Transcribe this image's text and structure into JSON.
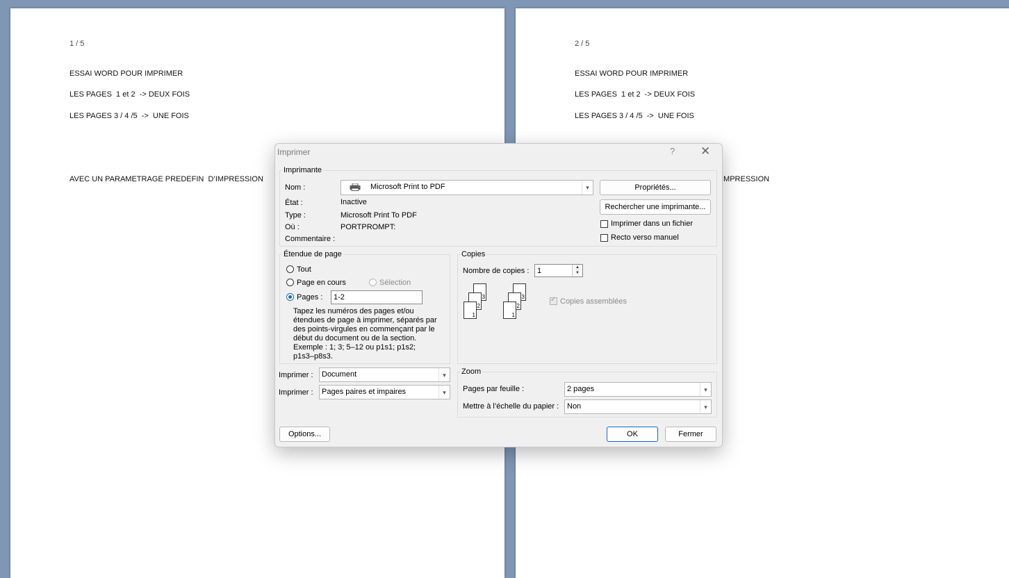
{
  "document": {
    "page_left": {
      "page_number": "1 / 5",
      "lines": [
        "ESSAI WORD POUR IMPRIMER",
        "LES PAGES  1 et 2  -> DEUX FOIS",
        "LES PAGES 3 / 4 /5  ->  UNE FOIS",
        "AVEC UN PARAMETRAGE PREDEFIN  D’IMPRESSION"
      ]
    },
    "page_right": {
      "page_number": "2 / 5",
      "lines": [
        "ESSAI WORD POUR IMPRIMER",
        "LES PAGES  1 et 2  -> DEUX FOIS",
        "LES PAGES 3 / 4 /5  ->  UNE FOIS",
        "IMPRESSION"
      ]
    }
  },
  "dialog": {
    "title": "Imprimer",
    "help": "?",
    "close": "✕",
    "printer": {
      "group_label": "Imprimante",
      "name_label": "Nom :",
      "name_value": "Microsoft Print to PDF",
      "status_label": "État :",
      "status_value": "Inactive",
      "type_label": "Type :",
      "type_value": "Microsoft Print To PDF",
      "where_label": "Où :",
      "where_value": "PORTPROMPT:",
      "comment_label": "Commentaire :",
      "properties_button": "Propriétés...",
      "find_printer_button": "Rechercher une imprimante...",
      "print_to_file_label": "Imprimer dans un fichier",
      "manual_duplex_label": "Recto verso manuel"
    },
    "page_range": {
      "group_label": "Étendue de page",
      "all_label": "Tout",
      "current_page_label": "Page en cours",
      "selection_label": "Sélection",
      "pages_label": "Pages :",
      "pages_value": "1-2",
      "help_lines": [
        "Tapez les numéros des pages et/ou",
        "étendues de page à imprimer, séparés par",
        "des points-virgules en commençant par le",
        "début du document ou de la section.",
        "Exemple : 1; 3; 5–12 ou p1s1; p1s2;",
        "p1s3–p8s3."
      ]
    },
    "print_what": {
      "label": "Imprimer :",
      "value": "Document"
    },
    "print_pages": {
      "label": "Imprimer :",
      "value": "Pages paires et impaires"
    },
    "copies": {
      "group_label": "Copies",
      "count_label": "Nombre de copies :",
      "count_value": "1",
      "collate_label": "Copies assemblées",
      "sheet_numbers": [
        "1",
        "2",
        "3"
      ]
    },
    "zoom": {
      "group_label": "Zoom",
      "pages_per_sheet_label": "Pages par feuille :",
      "pages_per_sheet_value": "2 pages",
      "scale_label": "Mettre à l’échelle du papier :",
      "scale_value": "Non"
    },
    "buttons": {
      "options": "Options...",
      "ok": "OK",
      "close": "Fermer"
    }
  }
}
